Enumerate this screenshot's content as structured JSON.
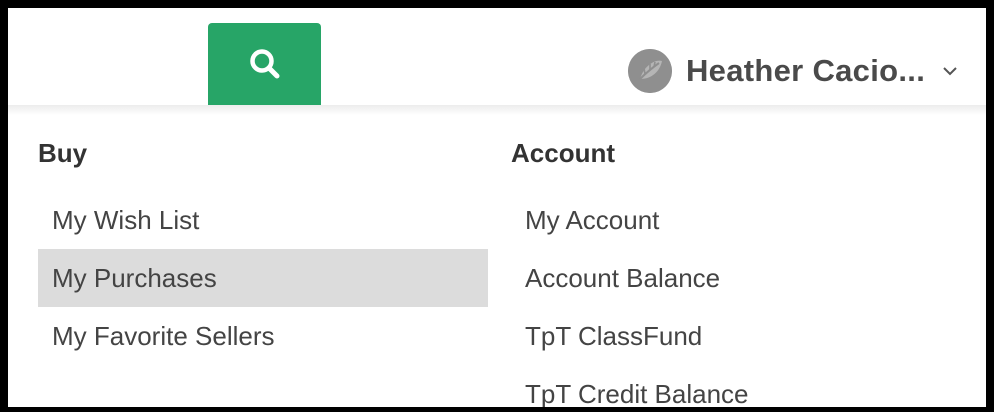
{
  "header": {
    "search_icon": "search-icon",
    "user_name": "Heather Cacio...",
    "avatar_icon": "leaf-avatar-icon",
    "chevron_icon": "chevron-down-icon",
    "accent_color": "#27a567"
  },
  "menu": {
    "buy": {
      "title": "Buy",
      "items": [
        {
          "label": "My Wish List"
        },
        {
          "label": "My Purchases"
        },
        {
          "label": "My Favorite Sellers"
        }
      ]
    },
    "account": {
      "title": "Account",
      "items": [
        {
          "label": "My Account"
        },
        {
          "label": "Account Balance"
        },
        {
          "label": "TpT ClassFund"
        },
        {
          "label": "TpT Credit Balance"
        }
      ]
    },
    "active_item": "My Purchases",
    "active_bg": "#dcdcdc"
  }
}
